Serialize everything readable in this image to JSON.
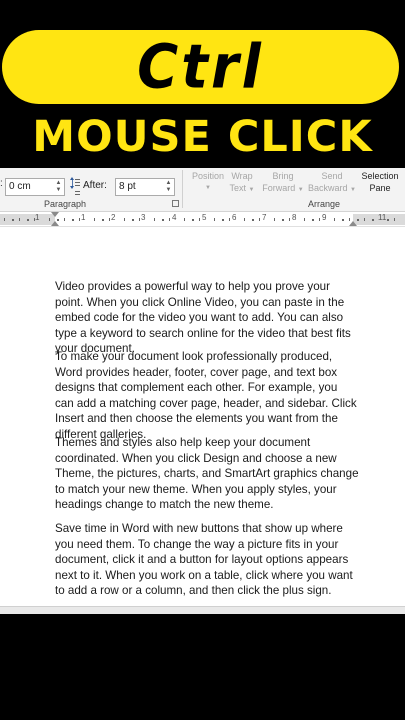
{
  "overlay": {
    "pill_text": "Ctrl",
    "headline": "MOUSE CLICK",
    "accent_color": "#ffe512"
  },
  "ribbon": {
    "indent_right_value": "0 cm",
    "after_label": "After:",
    "after_value": "8 pt",
    "paragraph_group_label": "Paragraph",
    "arrange_group_label": "Arrange",
    "buttons": [
      {
        "line1": "Position",
        "line2": ""
      },
      {
        "line1": "Wrap",
        "line2": "Text"
      },
      {
        "line1": "Bring",
        "line2": "Forward"
      },
      {
        "line1": "Send",
        "line2": "Backward"
      },
      {
        "line1": "Selection",
        "line2": "Pane"
      }
    ]
  },
  "ruler": {
    "numbers": [
      "1",
      "1",
      "2",
      "3",
      "4",
      "5",
      "6",
      "7",
      "8",
      "9",
      "11"
    ]
  },
  "document": {
    "paragraphs": [
      "Video provides a powerful way to help you prove your point. When you click Online Video, you can paste in the embed code for the video you want to add. You can also type a keyword to search online for the video that best fits your document.",
      "To make your document look professionally produced, Word provides header, footer, cover page, and text box designs that complement each other. For example, you can add a matching cover page, header, and sidebar. Click Insert and then choose the elements you want from the different galleries.",
      "Themes and styles also help keep your document coordinated. When you click Design and choose a new Theme, the pictures, charts, and SmartArt graphics change to match your new theme. When you apply styles, your headings change to match the new theme.",
      "Save time in Word with new buttons that show up where you need them. To change the way a picture fits in your document, click it and a button for layout options appears next to it. When you work on a table, click where you want to add a row or a column, and then click the plus sign."
    ]
  }
}
